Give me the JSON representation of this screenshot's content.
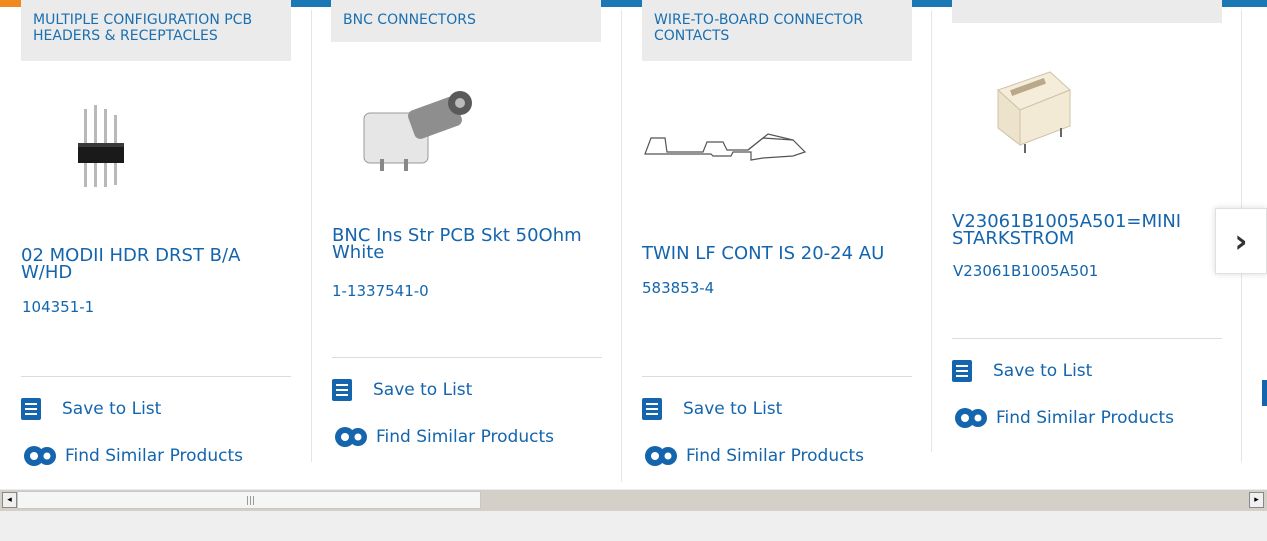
{
  "cards": [
    {
      "category": "MULTIPLE CONFIGURATION PCB HEADERS & RECEPTACLES",
      "name": "02 MODII HDR DRST B/A W/HD",
      "part_number": "104351-1",
      "image": "pcb-header-image"
    },
    {
      "category": "BNC CONNECTORS",
      "name": "BNC Ins Str PCB Skt 50Ohm White",
      "part_number": "1-1337541-0",
      "image": "bnc-connector-image"
    },
    {
      "category": "WIRE-TO-BOARD CONNECTOR CONTACTS",
      "name": "TWIN LF CONT IS 20-24 AU",
      "part_number": "583853-4",
      "image": "contact-image"
    },
    {
      "category": "",
      "name": "V23061B1005A501=MINISTARKSTROM",
      "part_number": "V23061B1005A501",
      "image": "relay-image"
    }
  ],
  "actions": {
    "save_label": "Save to List",
    "find_label": "Find Similar Products",
    "save_icon": "list-check-icon",
    "find_icon": "gears-icon"
  },
  "carousel": {
    "next_icon": "chevron-right-icon",
    "next_glyph": "›"
  },
  "scrollbar": {
    "left_glyph": "◂",
    "right_glyph": "▸"
  },
  "colors": {
    "accent_bar": "#1a79b4",
    "accent_orange": "#f08a1f",
    "link": "#1465ad",
    "category_bg": "#ebebeb"
  }
}
